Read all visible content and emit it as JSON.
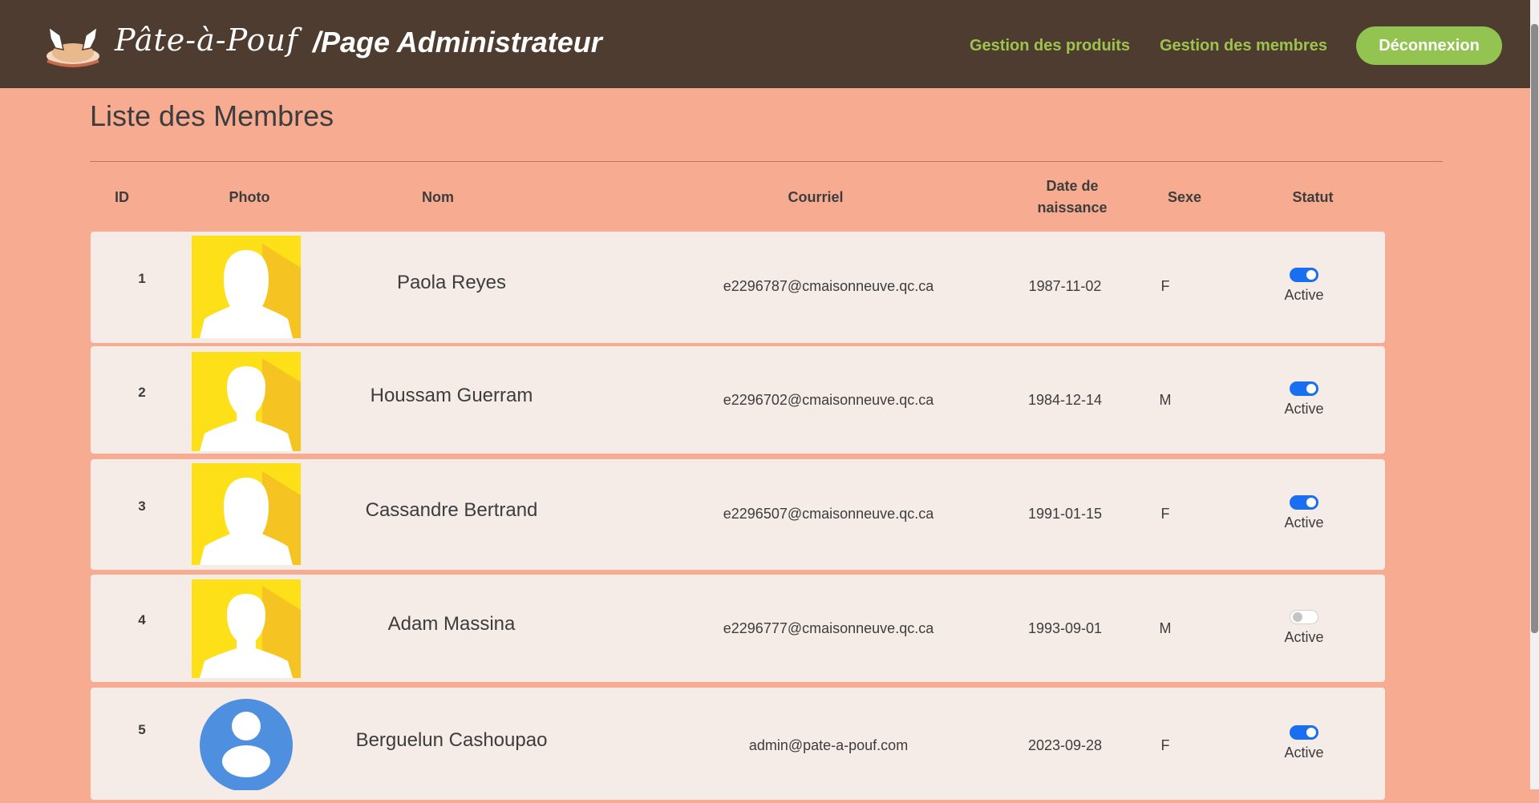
{
  "header": {
    "brand": "Pâte-à-Pouf",
    "page_label": "/Page Administrateur",
    "nav": {
      "products": "Gestion des produits",
      "members": "Gestion des membres"
    },
    "logout_label": "Déconnexion",
    "colors": {
      "bar": "#4f3c31",
      "link": "#9cc44c",
      "button": "#93c350"
    }
  },
  "main": {
    "title": "Liste des Membres",
    "columns": {
      "id": "ID",
      "photo": "Photo",
      "name": "Nom",
      "email": "Courriel",
      "birth": "Date de naissance",
      "sex": "Sexe",
      "status": "Statut"
    },
    "members": [
      {
        "id": "1",
        "avatar": "female-silhouette",
        "name": "Paola Reyes",
        "email": "e2296787@cmaisonneuve.qc.ca",
        "birth": "1987-11-02",
        "sex": "F",
        "active": true,
        "status_label": "Active"
      },
      {
        "id": "2",
        "avatar": "male-silhouette",
        "name": "Houssam Guerram",
        "email": "e2296702@cmaisonneuve.qc.ca",
        "birth": "1984-12-14",
        "sex": "M",
        "active": true,
        "status_label": "Active"
      },
      {
        "id": "3",
        "avatar": "female-silhouette",
        "name": "Cassandre Bertrand",
        "email": "e2296507@cmaisonneuve.qc.ca",
        "birth": "1991-01-15",
        "sex": "F",
        "active": true,
        "status_label": "Active"
      },
      {
        "id": "4",
        "avatar": "male-silhouette",
        "name": "Adam Massina",
        "email": "e2296777@cmaisonneuve.qc.ca",
        "birth": "1993-09-01",
        "sex": "M",
        "active": false,
        "status_label": "Active"
      },
      {
        "id": "5",
        "avatar": "generic-user-circle",
        "name": "Berguelun Cashoupao",
        "email": "admin@pate-a-pouf.com",
        "birth": "2023-09-28",
        "sex": "F",
        "active": true,
        "status_label": "Active"
      }
    ]
  }
}
